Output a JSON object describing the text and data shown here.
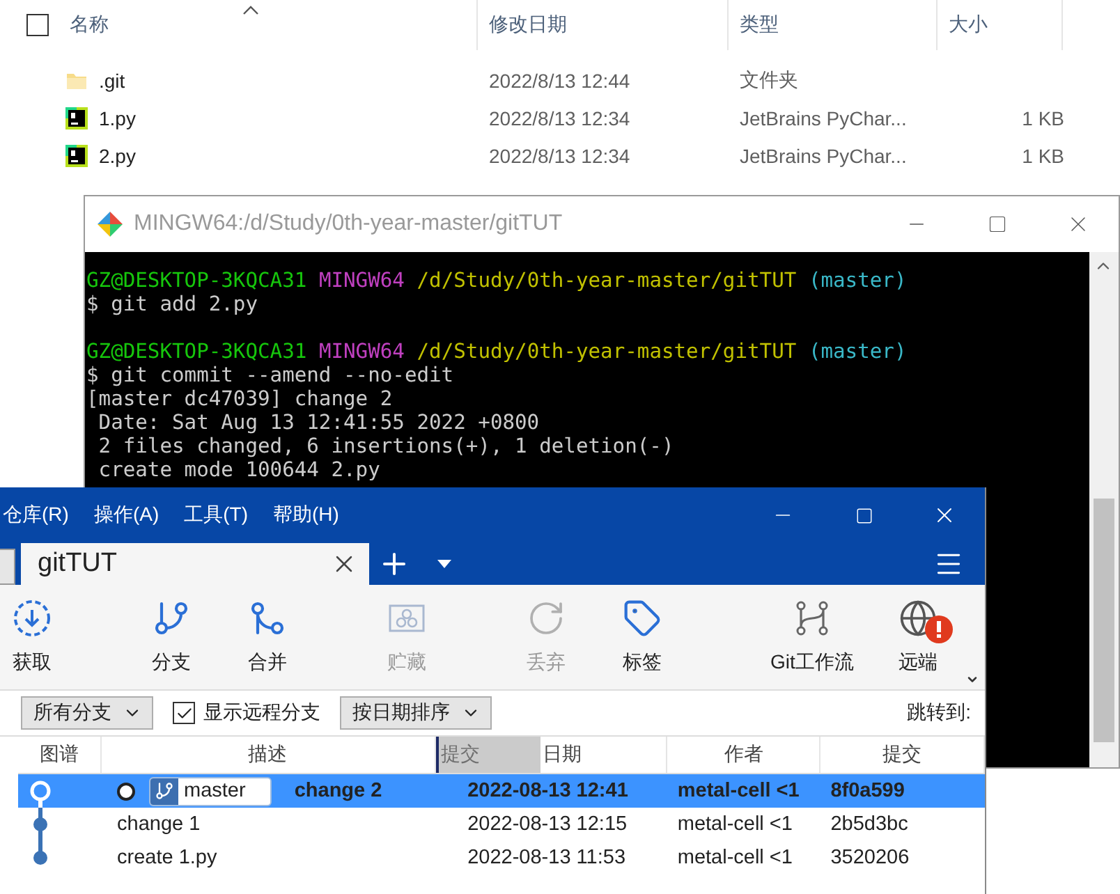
{
  "explorer": {
    "header_checkbox": {
      "checked": false
    },
    "columns": [
      {
        "label": "名称",
        "sorted": true
      },
      {
        "label": "修改日期",
        "sorted": false
      },
      {
        "label": "类型",
        "sorted": false
      },
      {
        "label": "大小",
        "sorted": false
      }
    ],
    "rows": [
      {
        "kind": "folder",
        "name": ".git",
        "date": "2022/8/13 12:44",
        "type": "文件夹"
      },
      {
        "kind": "python",
        "name": "1.py",
        "date": "2022/8/13 12:34",
        "type": "JetBrains PyChar...",
        "size": "1 KB"
      },
      {
        "kind": "python",
        "name": "2.py",
        "date": "2022/8/13 12:34",
        "type": "JetBrains PyChar...",
        "size": "1 KB"
      }
    ]
  },
  "terminal": {
    "title": "MINGW64:/d/Study/0th-year-master/gitTUT",
    "lines": [
      {
        "kind": "prompt",
        "user": "GZ@DESKTOP-3KQCA31",
        "host": "MINGW64",
        "path": "/d/Study/0th-year-master/gitTUT",
        "branch": "(master)"
      },
      {
        "kind": "text",
        "text": "$ git add 2.py"
      },
      {
        "kind": "blank"
      },
      {
        "kind": "prompt",
        "user": "GZ@DESKTOP-3KQCA31",
        "host": "MINGW64",
        "path": "/d/Study/0th-year-master/gitTUT",
        "branch": "(master)"
      },
      {
        "kind": "text",
        "text": "$ git commit --amend --no-edit"
      },
      {
        "kind": "text",
        "text": "[master dc47039] change 2"
      },
      {
        "kind": "text",
        "text": " Date: Sat Aug 13 12:41:55 2022 +0800"
      },
      {
        "kind": "text",
        "text": " 2 files changed, 6 insertions(+), 1 deletion(-)"
      },
      {
        "kind": "text",
        "text": " create mode 100644 2.py"
      }
    ]
  },
  "sourcetree": {
    "menus": [
      "仓库(R)",
      "操作(A)",
      "工具(T)",
      "帮助(H)"
    ],
    "tabs": [
      {
        "label": "gitTUT",
        "selected": true
      }
    ],
    "toolbar": [
      {
        "kind": "fetch",
        "label": "获取",
        "disabled": false,
        "alert": false
      },
      {
        "kind": "branch",
        "label": "分支",
        "disabled": false,
        "alert": false
      },
      {
        "kind": "merge",
        "label": "合并",
        "disabled": false,
        "alert": false
      },
      {
        "kind": "stash",
        "label": "贮藏",
        "disabled": true,
        "alert": false
      },
      {
        "kind": "discard",
        "label": "丢弃",
        "disabled": true,
        "alert": false
      },
      {
        "kind": "tag",
        "label": "标签",
        "disabled": false,
        "alert": false
      },
      {
        "kind": "flow",
        "label": "Git工作流",
        "disabled": false,
        "alert": false
      },
      {
        "kind": "remote",
        "label": "远端",
        "disabled": false,
        "alert": true
      }
    ],
    "filters": {
      "branches": "所有分支",
      "show_remote": {
        "label": "显示远程分支",
        "checked": true
      },
      "sort": "按日期排序",
      "jump_to": "跳转到:"
    },
    "table": {
      "columns": [
        "图谱",
        "描述",
        "日期",
        "作者",
        "提交"
      ],
      "dragged_column": "提交",
      "rows": [
        {
          "selected": true,
          "head": true,
          "branch": "master",
          "description": "change 2",
          "date": "2022-08-13 12:41",
          "author": "metal-cell <1",
          "commit": "8f0a599"
        },
        {
          "selected": false,
          "head": false,
          "description": "change 1",
          "date": "2022-08-13 12:15",
          "author": "metal-cell <1",
          "commit": "2b5d3bc"
        },
        {
          "selected": false,
          "head": false,
          "description": "create 1.py",
          "date": "2022-08-13 11:53",
          "author": "metal-cell <1",
          "commit": "3520206"
        }
      ]
    }
  }
}
